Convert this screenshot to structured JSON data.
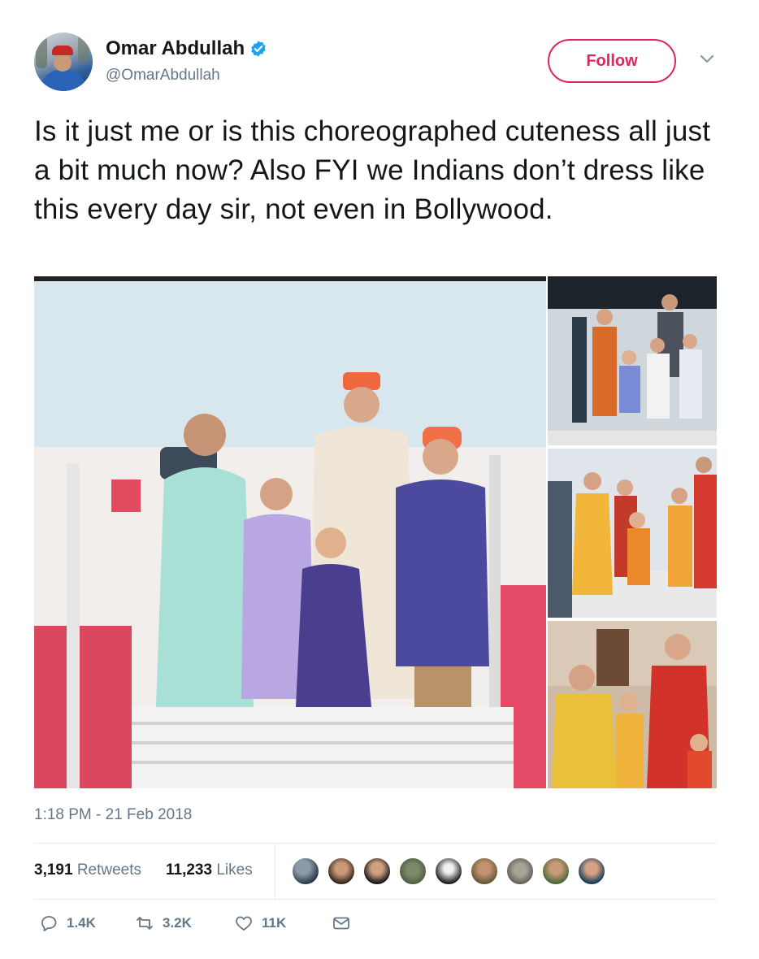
{
  "user": {
    "display_name": "Omar Abdullah",
    "handle": "@OmarAbdullah",
    "verified": true
  },
  "follow_label": "Follow",
  "tweet": {
    "text": "Is it just me or is this choreographed cuteness all just a bit much now? Also FYI we Indians don’t dress like this every day sir, not even in Bollywood."
  },
  "timestamp": "1:18 PM - 21 Feb 2018",
  "stats": {
    "retweets_count": "3,191",
    "retweets_label": "Retweets",
    "likes_count": "11,233",
    "likes_label": "Likes"
  },
  "liker_avatars": 9,
  "actions": {
    "reply_count": "1.4K",
    "retweet_count": "3.2K",
    "like_count": "11K"
  },
  "colors": {
    "follow": "#e0245e",
    "verified": "#1da1f2",
    "secondary_text": "#657786"
  },
  "icons": [
    "verified-badge-icon",
    "chevron-down-icon",
    "reply-icon",
    "retweet-icon",
    "heart-icon",
    "direct-message-icon"
  ]
}
